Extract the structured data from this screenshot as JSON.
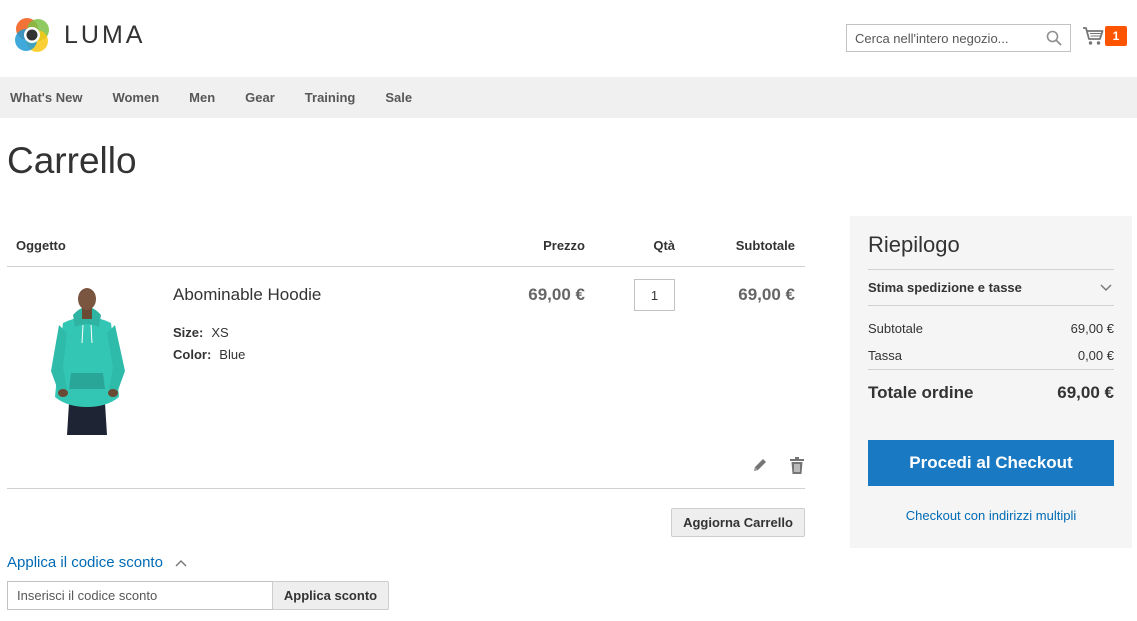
{
  "header": {
    "brand": "LUMA",
    "search_placeholder": "Cerca nell'intero negozio...",
    "cart_count": "1",
    "colors": {
      "cart_badge": "#ff5501"
    }
  },
  "nav": {
    "items": [
      "What's New",
      "Women",
      "Men",
      "Gear",
      "Training",
      "Sale"
    ]
  },
  "page": {
    "title": "Carrello"
  },
  "cart": {
    "columns": {
      "item": "Oggetto",
      "price": "Prezzo",
      "qty": "Qtà",
      "subtotal": "Subtotale"
    },
    "items": [
      {
        "name": "Abominable Hoodie",
        "options": [
          {
            "label": "Size:",
            "value": "XS"
          },
          {
            "label": "Color:",
            "value": "Blue"
          }
        ],
        "price": "69,00 €",
        "qty": "1",
        "subtotal": "69,00 €",
        "image_icon": "hoodie-product-image"
      }
    ],
    "update_label": "Aggiorna Carrello",
    "discount": {
      "toggle_label": "Applica il codice sconto",
      "placeholder": "Inserisci il codice sconto",
      "apply_label": "Applica sconto"
    }
  },
  "summary": {
    "title": "Riepilogo",
    "estimate_label": "Stima spedizione e tasse",
    "subtotal_label": "Subtotale",
    "subtotal_value": "69,00 €",
    "tax_label": "Tassa",
    "tax_value": "0,00 €",
    "total_label": "Totale ordine",
    "total_value": "69,00 €",
    "checkout_label": "Procedi al Checkout",
    "multi_address_label": "Checkout con indirizzi multipli",
    "colors": {
      "checkout": "#1979c3",
      "link": "#006bb4"
    }
  }
}
